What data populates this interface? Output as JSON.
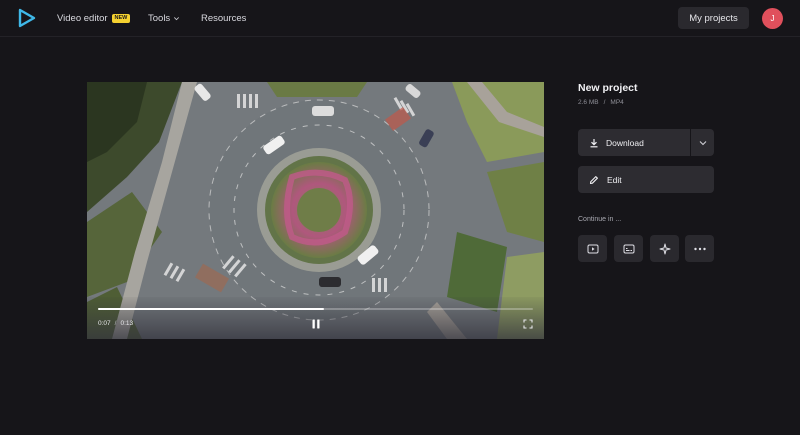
{
  "header": {
    "nav": [
      {
        "label": "Video editor",
        "badge": "NEW"
      },
      {
        "label": "Tools"
      },
      {
        "label": "Resources"
      }
    ],
    "my_projects_label": "My projects",
    "avatar_initial": "J",
    "colors": {
      "accent": "#3fb8e8",
      "badge": "#f5d130",
      "avatar": "#e0505c"
    }
  },
  "player": {
    "current_time": "0:07",
    "separator": "/",
    "duration": "0:13",
    "progress": 0.52,
    "pause_icon": "pause-icon",
    "fullscreen_icon": "fullscreen-icon"
  },
  "project": {
    "title": "New project",
    "size": "2.6 MB",
    "meta_separator": "/",
    "format": "MP4"
  },
  "actions": {
    "download_label": "Download",
    "edit_label": "Edit"
  },
  "continue": {
    "label": "Continue in ...",
    "icons": [
      "video-player-icon",
      "subtitles-icon",
      "sparkle-icon",
      "more-icon"
    ]
  }
}
